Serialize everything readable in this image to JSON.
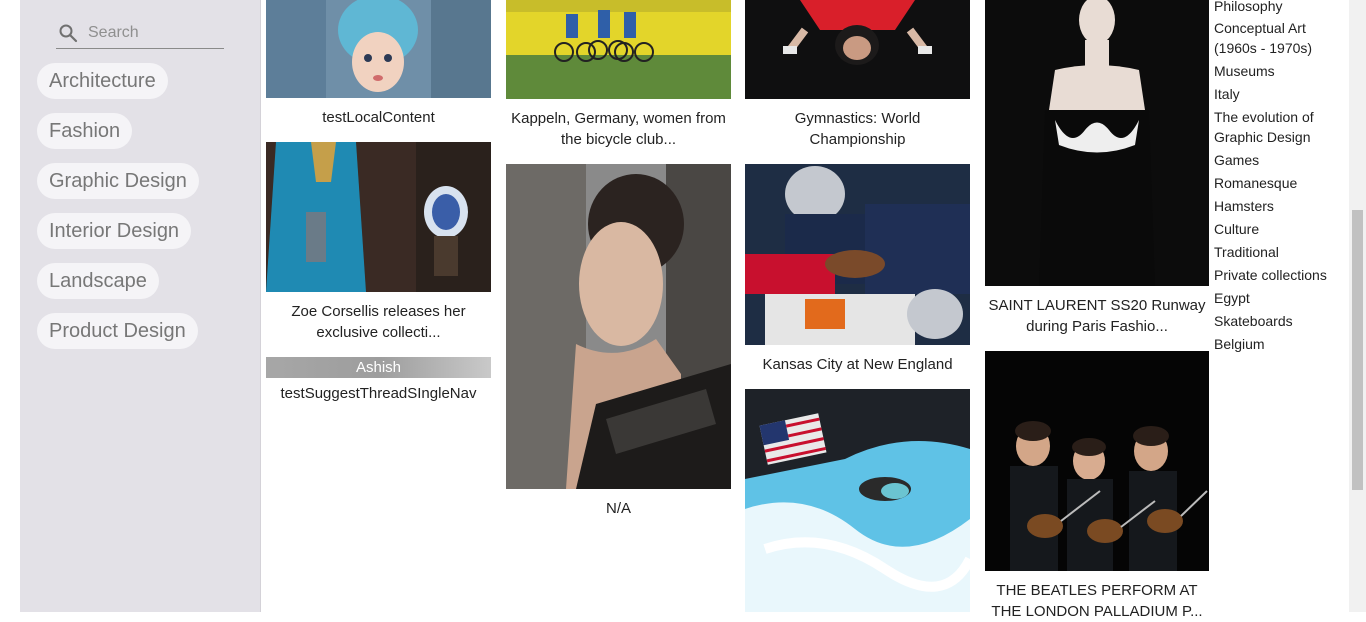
{
  "search": {
    "placeholder": "Search"
  },
  "categories": [
    "Architecture",
    "Fashion",
    "Graphic Design",
    "Interior Design",
    "Landscape",
    "Product Design"
  ],
  "cards": {
    "doll": {
      "caption": "testLocalContent"
    },
    "bikes": {
      "caption": "Kappeln, Germany, women from the bicycle club..."
    },
    "gymnastics": {
      "caption": "Gymnastics: World Championship"
    },
    "runway": {
      "caption": "SAINT LAURENT SS20 Runway during Paris Fashio..."
    },
    "zoe": {
      "caption": "Zoe Corsellis releases her exclusive collecti..."
    },
    "suggest": {
      "author": "Ashish",
      "caption": "testSuggestThreadSIngleNav"
    },
    "portrait": {
      "caption": "N/A"
    },
    "football": {
      "caption": "Kansas City at New England"
    },
    "swimmer": {
      "caption": ""
    },
    "beatles": {
      "caption": "THE BEATLES PERFORM AT THE LONDON PALLADIUM P..."
    }
  },
  "tags": [
    "Philosophy",
    "Conceptual Art (1960s - 1970s)",
    "Museums",
    "Italy",
    "The evolution of Graphic Design",
    "Games",
    "Romanesque",
    "Hamsters",
    "Culture",
    "Traditional",
    "Private collections",
    "Egypt",
    "Skateboards",
    "Belgium"
  ]
}
